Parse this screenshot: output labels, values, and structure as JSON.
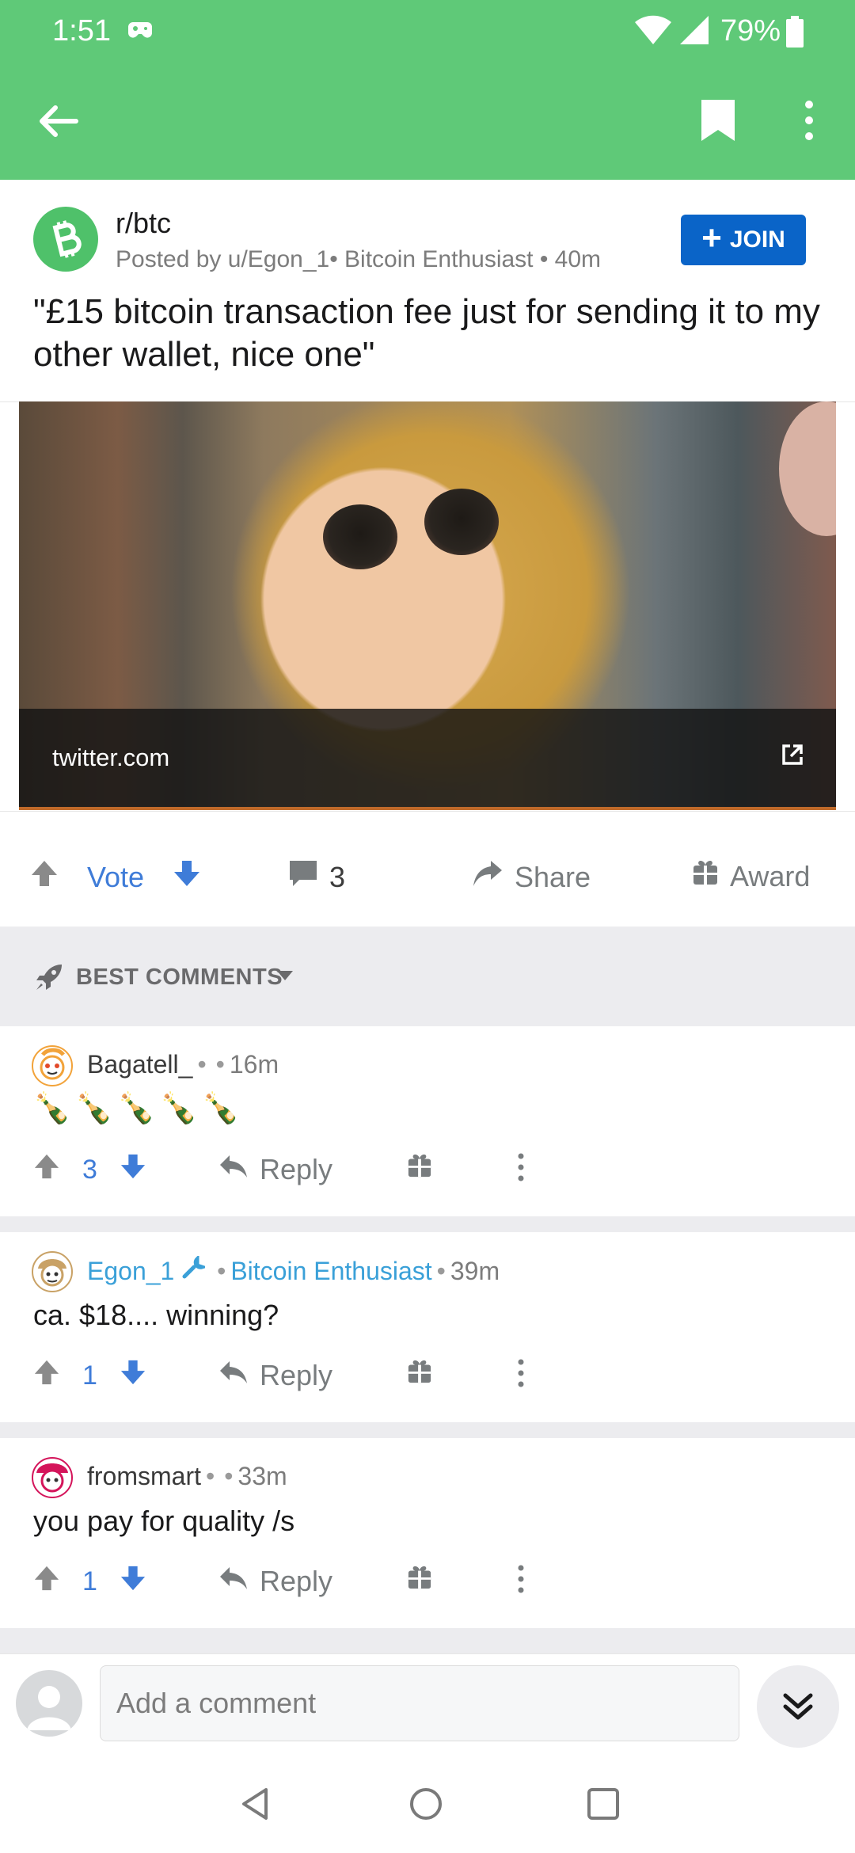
{
  "status_bar": {
    "time": "1:51",
    "battery": "79%"
  },
  "post": {
    "subreddit": "r/btc",
    "meta": "Posted by u/Egon_1• Bitcoin Enthusiast • 40m",
    "join_label": "JOIN",
    "title": "\"£15 bitcoin transaction fee just for sending it to my other wallet, nice one\"",
    "link_domain": "twitter.com",
    "vote_label": "Vote",
    "comment_count": "3",
    "share_label": "Share",
    "award_label": "Award"
  },
  "sort": {
    "label": "BEST COMMENTS"
  },
  "comments": [
    {
      "user": "Bagatell_",
      "time": "16m",
      "body": "🍾🍾🍾🍾🍾",
      "score": "3",
      "reply_label": "Reply"
    },
    {
      "user": "Egon_1",
      "flair": "Bitcoin Enthusiast",
      "time": "39m",
      "body": "ca. $18.... winning?",
      "score": "1",
      "reply_label": "Reply"
    },
    {
      "user": "fromsmart",
      "time": "33m",
      "body": "you pay for quality /s",
      "score": "1",
      "reply_label": "Reply"
    }
  ],
  "composer": {
    "placeholder": "Add a comment"
  },
  "colors": {
    "header_green": "#5fc978",
    "join_blue": "#0a64c8",
    "vote_blue": "#3f7cd8",
    "flair_blue": "#3aa0d8"
  }
}
